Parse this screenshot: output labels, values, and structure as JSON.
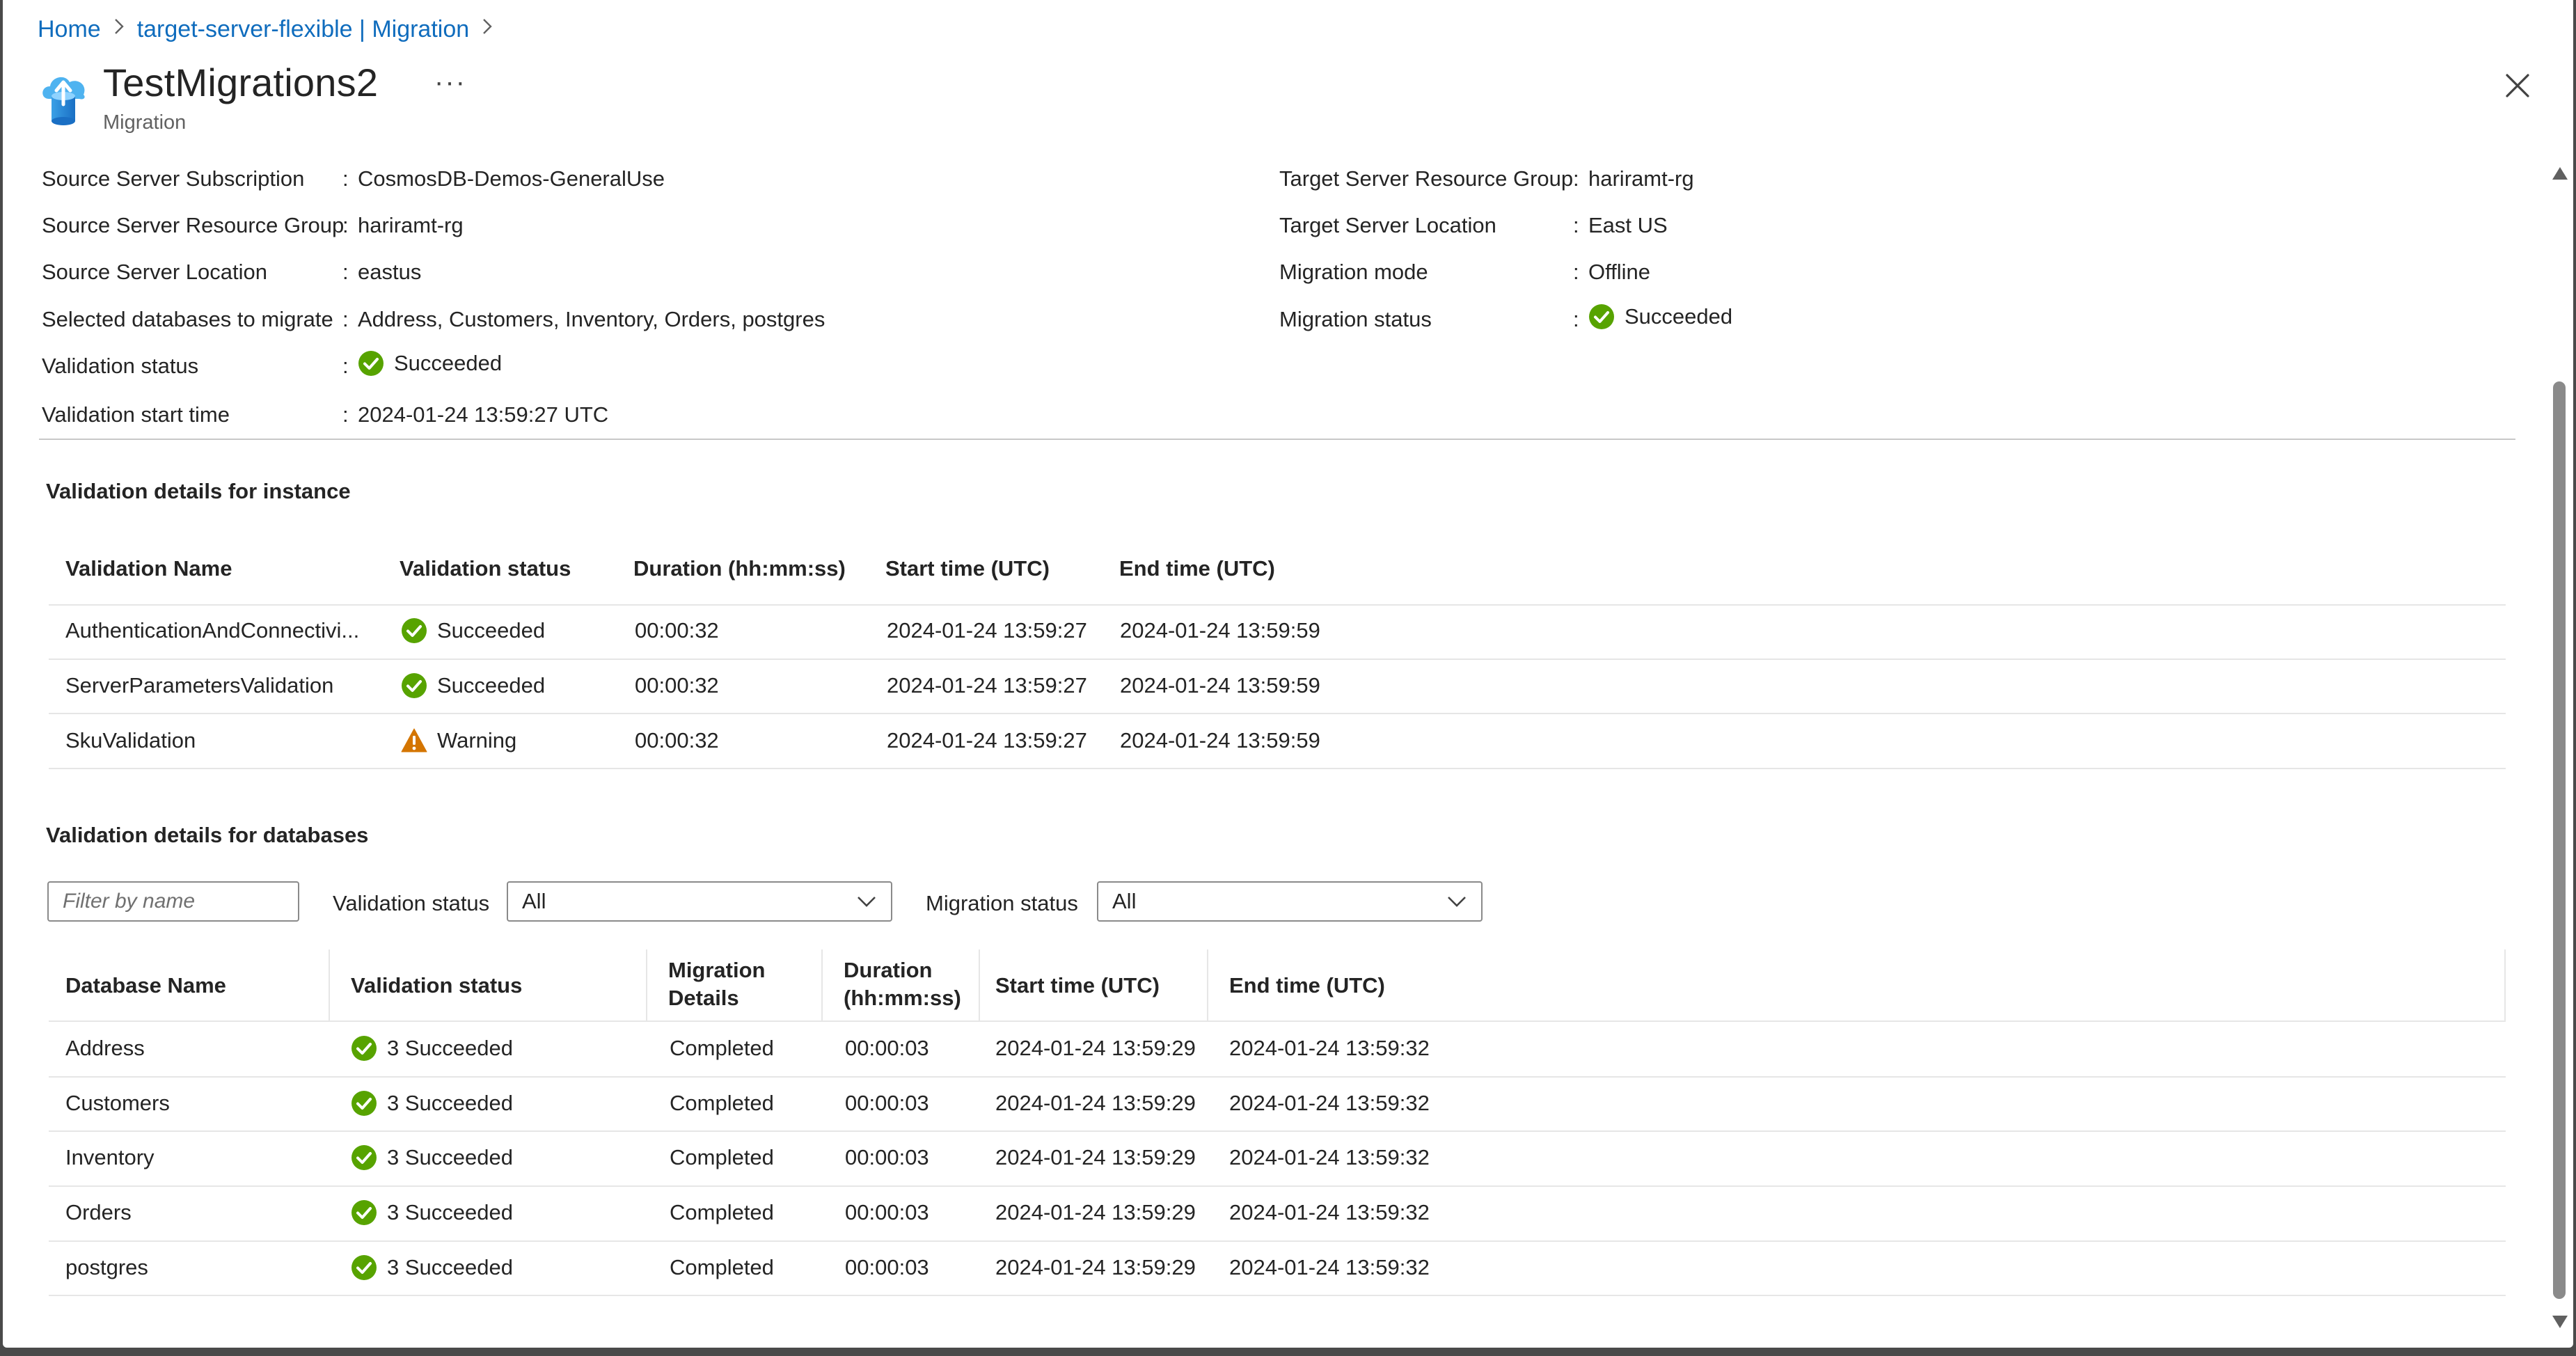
{
  "breadcrumb": {
    "home": "Home",
    "parent": "target-server-flexible | Migration"
  },
  "header": {
    "title": "TestMigrations2",
    "subtitle": "Migration",
    "more": "···"
  },
  "icons": {
    "resource": "migration-cloud-icon",
    "close": "close-icon",
    "more": "more-icon",
    "success": "checkmark-circle-icon",
    "warning": "warning-triangle-icon",
    "dropdown": "chevron-down-icon"
  },
  "colors": {
    "link": "#0f6cbd",
    "success": "#57a300",
    "warning": "#d47500",
    "text": "#242424"
  },
  "left_props": [
    {
      "label": "Source Server Subscription",
      "value": "CosmosDB-Demos-GeneralUse",
      "status": null
    },
    {
      "label": "Source Server Resource Group",
      "value": "hariramt-rg",
      "status": null
    },
    {
      "label": "Source Server Location",
      "value": "eastus",
      "status": null
    },
    {
      "label": "Selected databases to migrate",
      "value": "Address, Customers, Inventory, Orders, postgres",
      "status": null
    },
    {
      "label": "Validation status",
      "value": "Succeeded",
      "status": "success"
    },
    {
      "label": "Validation start time",
      "value": "2024-01-24 13:59:27 UTC",
      "status": null
    }
  ],
  "right_props": [
    {
      "label": "Target Server Resource Group",
      "value": "hariramt-rg",
      "status": null
    },
    {
      "label": "Target Server Location",
      "value": "East US",
      "status": null
    },
    {
      "label": "Migration mode",
      "value": "Offline",
      "status": null
    },
    {
      "label": "Migration status",
      "value": "Succeeded",
      "status": "success"
    }
  ],
  "colon": ":",
  "instance_section": {
    "title": "Validation details for instance",
    "headers": [
      "Validation Name",
      "Validation status",
      "Duration (hh:mm:ss)",
      "Start time (UTC)",
      "End time (UTC)"
    ],
    "rows": [
      {
        "name": "AuthenticationAndConnectivi...",
        "link": false,
        "status": "Succeeded",
        "status_type": "success",
        "duration": "00:00:32",
        "start": "2024-01-24 13:59:27",
        "end": "2024-01-24 13:59:59"
      },
      {
        "name": "ServerParametersValidation",
        "link": false,
        "status": "Succeeded",
        "status_type": "success",
        "duration": "00:00:32",
        "start": "2024-01-24 13:59:27",
        "end": "2024-01-24 13:59:59"
      },
      {
        "name": "SkuValidation",
        "link": true,
        "status": "Warning",
        "status_type": "warning",
        "duration": "00:00:32",
        "start": "2024-01-24 13:59:27",
        "end": "2024-01-24 13:59:59"
      }
    ]
  },
  "db_section": {
    "title": "Validation details for databases",
    "filter_placeholder": "Filter by name",
    "validation_filter_label": "Validation status",
    "validation_filter_value": "All",
    "migration_filter_label": "Migration status",
    "migration_filter_value": "All",
    "headers": [
      "Database Name",
      "Validation status",
      "Migration Details",
      "Duration (hh:mm:ss)",
      "Start time (UTC)",
      "End time (UTC)"
    ],
    "rows": [
      {
        "name": "Address",
        "status": "3 Succeeded",
        "details": "Completed",
        "duration": "00:00:03",
        "start": "2024-01-24 13:59:29",
        "end": "2024-01-24 13:59:32"
      },
      {
        "name": "Customers",
        "status": "3 Succeeded",
        "details": "Completed",
        "duration": "00:00:03",
        "start": "2024-01-24 13:59:29",
        "end": "2024-01-24 13:59:32"
      },
      {
        "name": "Inventory",
        "status": "3 Succeeded",
        "details": "Completed",
        "duration": "00:00:03",
        "start": "2024-01-24 13:59:29",
        "end": "2024-01-24 13:59:32"
      },
      {
        "name": "Orders",
        "status": "3 Succeeded",
        "details": "Completed",
        "duration": "00:00:03",
        "start": "2024-01-24 13:59:29",
        "end": "2024-01-24 13:59:32"
      },
      {
        "name": "postgres",
        "status": "3 Succeeded",
        "details": "Completed",
        "duration": "00:00:03",
        "start": "2024-01-24 13:59:29",
        "end": "2024-01-24 13:59:32"
      }
    ]
  }
}
